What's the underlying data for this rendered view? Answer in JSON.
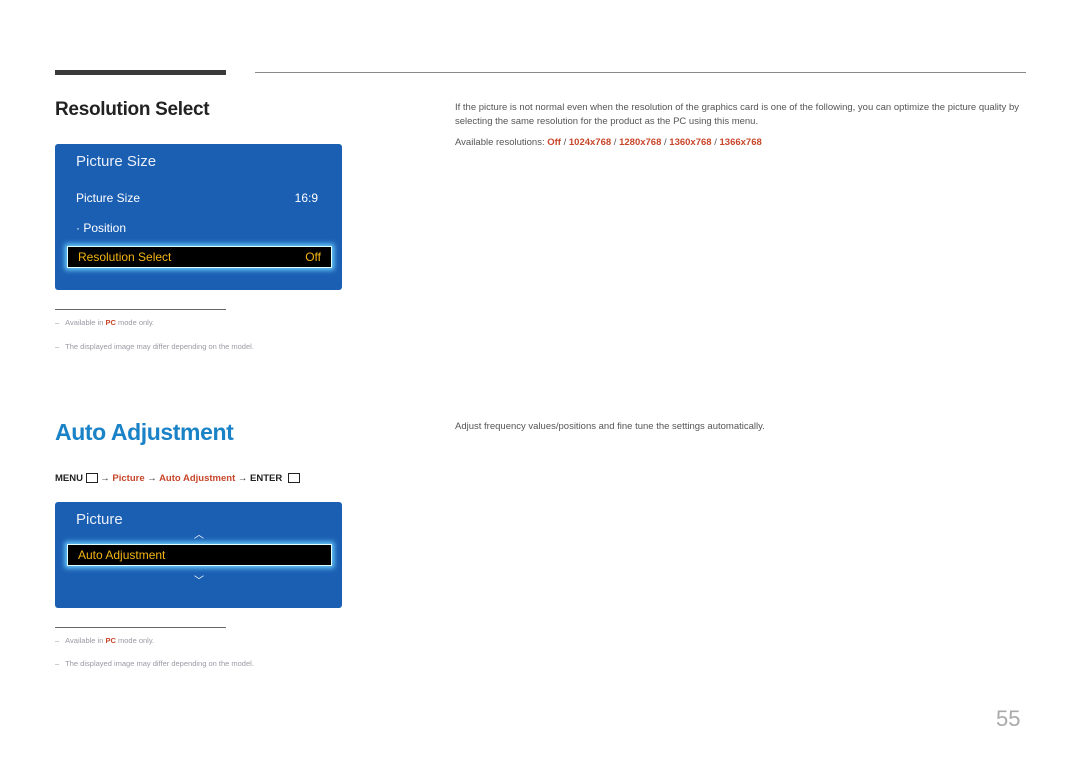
{
  "section1": {
    "heading": "Resolution Select",
    "osd": {
      "title": "Picture Size",
      "rows": [
        {
          "label": "Picture Size",
          "value": "16:9"
        },
        {
          "label": "· Position",
          "value": ""
        }
      ],
      "selected": {
        "label": "Resolution Select",
        "value": "Off"
      }
    },
    "notes": [
      {
        "prefix": "Available in ",
        "highlight": "PC",
        "suffix": " mode only."
      },
      {
        "text": "The displayed image may differ depending on the model."
      }
    ],
    "description": "If the picture is not normal even when the resolution of the graphics card is one of the following, you can optimize the picture quality by selecting the same resolution for the product as the PC using this menu.",
    "resolutions_label": "Available resolutions: ",
    "resolutions": [
      "Off",
      "1024x768",
      "1280x768",
      "1360x768",
      "1366x768"
    ],
    "separator": " / "
  },
  "section2": {
    "heading": "Auto Adjustment",
    "menu_path": {
      "menu": "MENU",
      "arrow": " → ",
      "picture": "Picture",
      "item": "Auto Adjustment",
      "enter": "ENTER"
    },
    "osd": {
      "title": "Picture",
      "selected": "Auto Adjustment"
    },
    "notes": [
      {
        "prefix": "Available in ",
        "highlight": "PC",
        "suffix": " mode only."
      },
      {
        "text": "The displayed image may differ depending on the model."
      }
    ],
    "description": "Adjust frequency values/positions and fine tune the settings automatically."
  },
  "page_number": "55",
  "colors": {
    "accent_blue": "#1a82c6",
    "osd_blue": "#1b5fb3",
    "highlight_red": "#c8462a",
    "selected_text": "#f3b513"
  }
}
